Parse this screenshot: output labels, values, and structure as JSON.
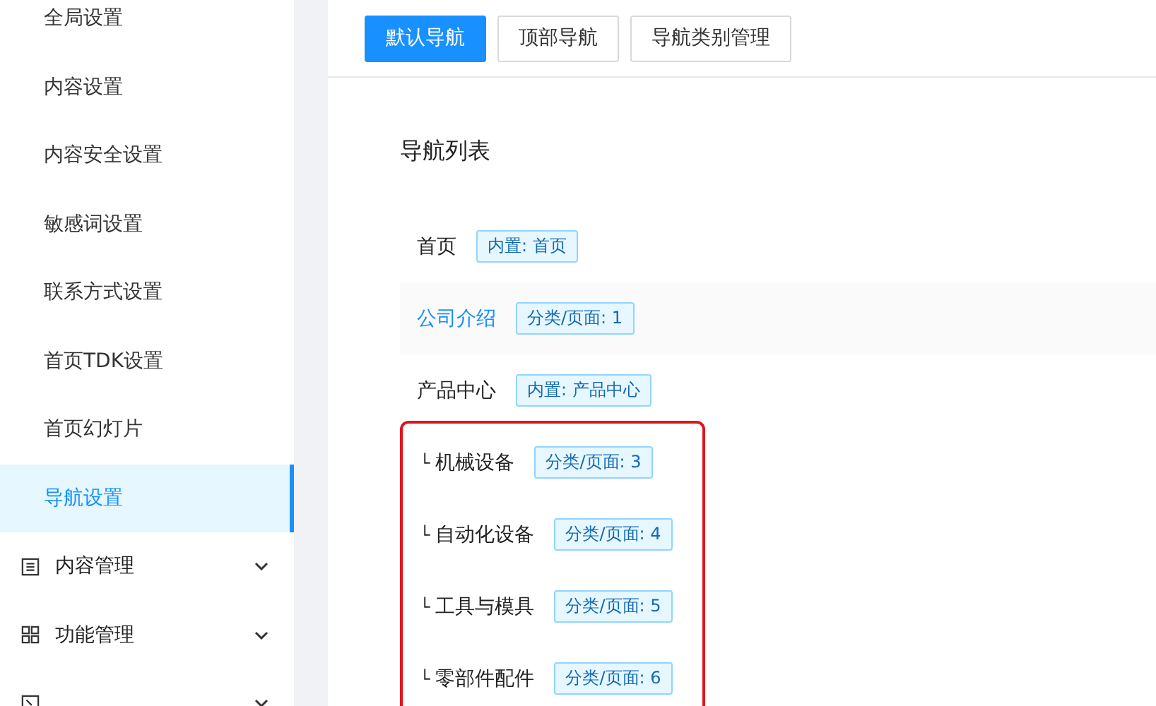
{
  "sidebar": {
    "items": [
      {
        "kind": "sub",
        "label": "全局设置",
        "selected": false
      },
      {
        "kind": "sub",
        "label": "内容设置",
        "selected": false
      },
      {
        "kind": "sub",
        "label": "内容安全设置",
        "selected": false
      },
      {
        "kind": "sub",
        "label": "敏感词设置",
        "selected": false
      },
      {
        "kind": "sub",
        "label": "联系方式设置",
        "selected": false
      },
      {
        "kind": "sub",
        "label": "首页TDK设置",
        "selected": false
      },
      {
        "kind": "sub",
        "label": "首页幻灯片",
        "selected": false
      },
      {
        "kind": "sub",
        "label": "导航设置",
        "selected": true
      },
      {
        "kind": "list_group",
        "label": "内容管理",
        "expanded": false
      },
      {
        "kind": "grid_group",
        "label": "功能管理",
        "expanded": false
      },
      {
        "kind": "layout_group",
        "expanded": false
      }
    ]
  },
  "tabs": [
    {
      "label": "默认导航",
      "selected": true
    },
    {
      "label": "顶部导航",
      "selected": false
    },
    {
      "label": "导航类别管理",
      "selected": false
    }
  ],
  "nav_list": {
    "title": "导航列表",
    "items": [
      {
        "label": "首页",
        "tag": "内置: 首页",
        "highlighted": false
      },
      {
        "label": "公司介绍",
        "tag": "分类/页面: 1",
        "highlighted": true
      },
      {
        "label": "产品中心",
        "tag": "内置: 产品中心",
        "highlighted": false,
        "children_framed": true,
        "children": [
          {
            "marker": "└",
            "label": "机械设备",
            "tag": "分类/页面: 3"
          },
          {
            "marker": "└",
            "label": "自动化设备",
            "tag": "分类/页面: 4"
          },
          {
            "marker": "└",
            "label": "工具与模具",
            "tag": "分类/页面: 5"
          },
          {
            "marker": "└",
            "label": "零部件配件",
            "tag": "分类/页面: 6"
          }
        ]
      }
    ]
  }
}
